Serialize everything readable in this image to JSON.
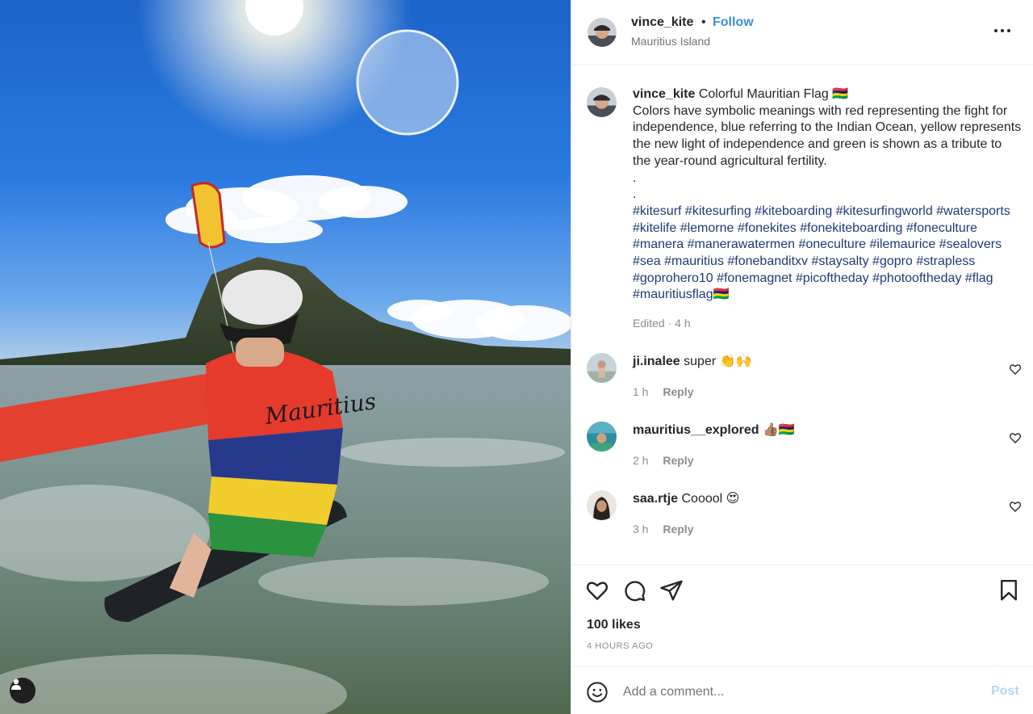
{
  "post": {
    "username": "vince_kite",
    "follow_label": "Follow",
    "separator": "•",
    "location": "Mauritius Island",
    "more_icon": "more-horizontal-icon",
    "photo_user_tag_icon": "person-icon"
  },
  "caption": {
    "username": "vince_kite",
    "title": "Colorful Mauritian Flag 🇲🇺",
    "body": "Colors have symbolic meanings with red representing the fight for independence, blue referring to the Indian Ocean, yellow represents the new light of independence and green is shown as a tribute to the year-round agricultural fertility.",
    "dot1": ".",
    "dot2": ".",
    "hashtags": "#kitesurf #kitesurfing #kiteboarding #kitesurfingworld #watersports #kitelife #lemorne #fonekites #fonekiteboarding #foneculture #manera #manerawatermen #oneculture #ilemaurice #sealovers #sea #mauritius #fonebanditxv #staysalty #gopro #strapless #goprohero10 #fonemagnet #picoftheday #photooftheday #flag #mauritiusflag🇲🇺",
    "edited": "Edited · 4 h"
  },
  "comments": [
    {
      "username": "ji.inalee",
      "text": "super 👏🙌",
      "time": "1 h",
      "reply": "Reply"
    },
    {
      "username": "mauritius__explored",
      "text": "👍🏽🇲🇺",
      "time": "2 h",
      "reply": "Reply"
    },
    {
      "username": "saa.rtje",
      "text": "Cooool 😍",
      "time": "3 h",
      "reply": "Reply"
    }
  ],
  "actions": {
    "likes": "100 likes",
    "time": "4 HOURS AGO",
    "icons": [
      "heart-icon",
      "comment-icon",
      "share-icon",
      "bookmark-icon"
    ]
  },
  "add_comment": {
    "placeholder": "Add a comment...",
    "post_label": "Post",
    "emoji_icon": "emoji-icon"
  },
  "colors": {
    "follow": "#3a8ee6",
    "hashtag": "#1e3a75",
    "post_disabled": "#b8d7f5",
    "muted": "#8e8e8e"
  }
}
